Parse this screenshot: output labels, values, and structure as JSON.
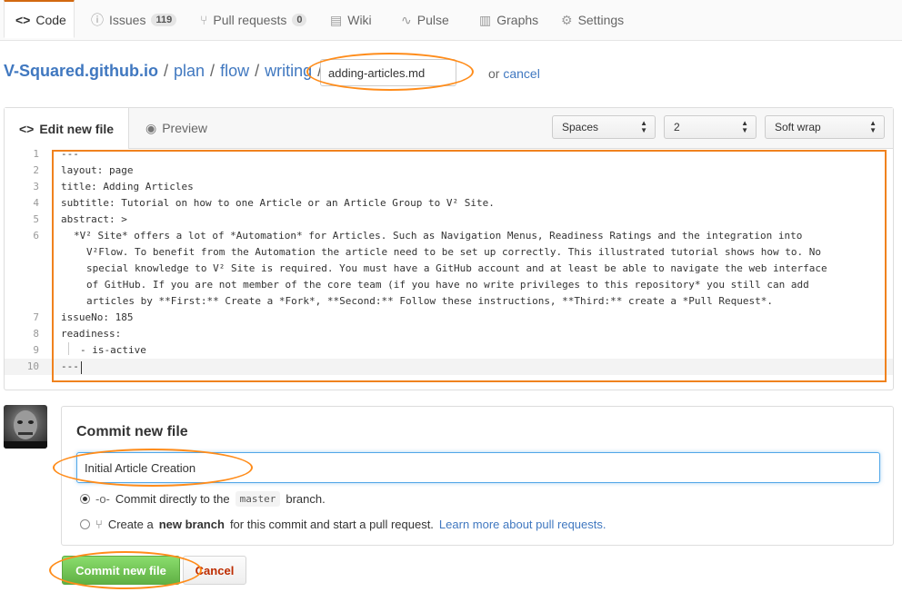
{
  "nav": {
    "code": "Code",
    "issues": "Issues",
    "issues_count": "119",
    "pulls": "Pull requests",
    "pulls_count": "0",
    "wiki": "Wiki",
    "pulse": "Pulse",
    "graphs": "Graphs",
    "settings": "Settings"
  },
  "breadcrumb": {
    "repo": "V-Squared.github.io",
    "sep": "/",
    "p1": "plan",
    "p2": "flow",
    "p3": "writing",
    "filename": "adding-articles.md",
    "or": "or",
    "cancel": "cancel"
  },
  "editor": {
    "tab_edit": "Edit new file",
    "tab_preview": "Preview",
    "indent_mode": "Spaces",
    "indent_size": "2",
    "wrap_mode": "Soft wrap",
    "lines": [
      {
        "n": "1",
        "text": "---"
      },
      {
        "n": "2",
        "text": "layout: page"
      },
      {
        "n": "3",
        "text": "title: Adding Articles"
      },
      {
        "n": "4",
        "text": "subtitle: Tutorial on how to one Article or an Article Group to V² Site."
      },
      {
        "n": "5",
        "text": "abstract: >"
      },
      {
        "n": "6",
        "text": "*V² Site* offers a lot of *Automation* for Articles. Such as Navigation Menus, Readiness Ratings and the integration into"
      },
      {
        "n": "",
        "text": "V²Flow. To benefit from the Automation the article need to be set up correctly. This illustrated tutorial shows how to. No"
      },
      {
        "n": "",
        "text": "special knowledge to V² Site is required. You must have a GitHub account and at least be able to navigate the web interface"
      },
      {
        "n": "",
        "text": "of GitHub. If you are not member of the core team (if you have no write privileges to this repository* you still can add"
      },
      {
        "n": "",
        "text": "articles by **First:** Create a *Fork*, **Second:** Follow these instructions, **Third:** create a *Pull Request*."
      },
      {
        "n": "7",
        "text": "issueNo: 185"
      },
      {
        "n": "8",
        "text": "readiness:"
      },
      {
        "n": "9",
        "text": "- is-active"
      },
      {
        "n": "10",
        "text": "---"
      }
    ]
  },
  "commit": {
    "title": "Commit new file",
    "message": "Initial Article Creation",
    "direct_prefix": "Commit directly to the",
    "branch": "master",
    "direct_suffix": "branch.",
    "new_prefix": "Create a",
    "new_bold": "new branch",
    "new_suffix": "for this commit and start a pull request.",
    "learn_more": "Learn more about pull requests.",
    "submit": "Commit new file",
    "cancel": "Cancel"
  },
  "colors": {
    "link": "#4078c0",
    "accent": "#d26911",
    "annotation": "#ff8c1a",
    "commit_button": "#60b044",
    "cancel_text": "#bd2c00"
  }
}
